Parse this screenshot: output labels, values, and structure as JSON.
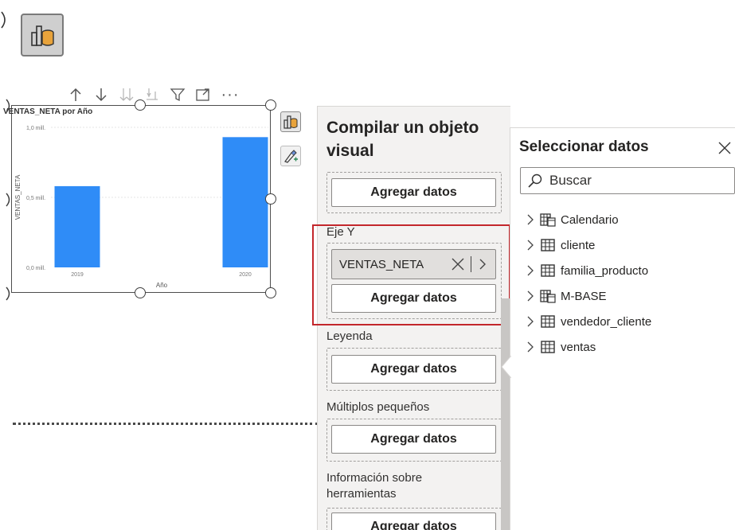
{
  "chart_data": {
    "type": "bar",
    "title": "VENTAS_NETA por Año",
    "xlabel": "Año",
    "ylabel": "VENTAS_NETA",
    "categories": [
      "2019",
      "2020"
    ],
    "values": [
      0.58,
      0.93
    ],
    "ylim": [
      0,
      1.0
    ],
    "y_ticks": [
      {
        "value": 1.0,
        "label": "1,0 mill."
      },
      {
        "value": 0.5,
        "label": "0,5 mill."
      },
      {
        "value": 0.0,
        "label": "0,0 mill."
      }
    ],
    "bar_color": "#2f8cf7",
    "grid": true
  },
  "build_pane": {
    "title": "Compilar un objeto visual",
    "wells": {
      "x_add": "Agregar datos",
      "y_label": "Eje Y",
      "y_field": "VENTAS_NETA",
      "y_add": "Agregar datos",
      "legend_label": "Leyenda",
      "legend_add": "Agregar datos",
      "small_multiples_label": "Múltiplos pequeños",
      "small_multiples_add": "Agregar datos",
      "tooltips_label": "Información sobre herramientas",
      "tooltips_add": "Agregar datos"
    }
  },
  "data_pane": {
    "title": "Seleccionar datos",
    "search_placeholder": "Buscar",
    "tables": [
      {
        "name": "Calendario",
        "icon": "calendar-table-icon"
      },
      {
        "name": "cliente",
        "icon": "table-icon"
      },
      {
        "name": "familia_producto",
        "icon": "table-icon"
      },
      {
        "name": "M-BASE",
        "icon": "calendar-table-icon"
      },
      {
        "name": "vendedor_cliente",
        "icon": "table-icon"
      },
      {
        "name": "ventas",
        "icon": "table-icon"
      }
    ]
  },
  "colors": {
    "highlight": "#c3272c",
    "pane_bg": "#f3f2f1",
    "bar": "#2f8cf7"
  }
}
